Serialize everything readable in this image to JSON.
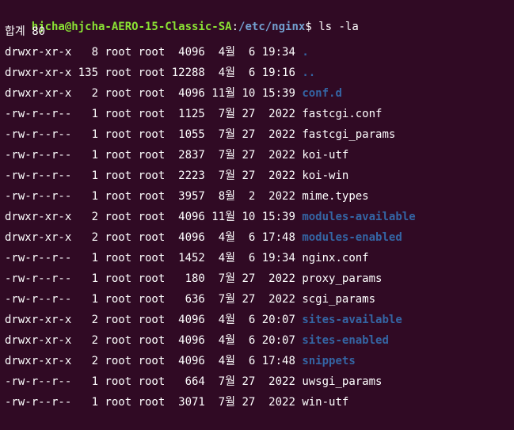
{
  "terminal": {
    "background": "#300a24",
    "colors": {
      "user": "#8ae234",
      "path": "#729fcf",
      "dir": "#3465a4",
      "text": "#ffffff"
    },
    "prompt": {
      "user_host": "hjcha@hjcha-AERO-15-Classic-SA",
      "colon": ":",
      "path": "/etc/nginx",
      "symbol": "$"
    },
    "command": "ls -la",
    "total": "합계 80",
    "entries": [
      {
        "meta": "drwxr-xr-x   8 root root  4096  4월  6 19:34 ",
        "name": ".",
        "type": "dir"
      },
      {
        "meta": "drwxr-xr-x 135 root root 12288  4월  6 19:16 ",
        "name": "..",
        "type": "dir"
      },
      {
        "meta": "drwxr-xr-x   2 root root  4096 11월 10 15:39 ",
        "name": "conf.d",
        "type": "dir"
      },
      {
        "meta": "-rw-r--r--   1 root root  1125  7월 27  2022 ",
        "name": "fastcgi.conf",
        "type": "file"
      },
      {
        "meta": "-rw-r--r--   1 root root  1055  7월 27  2022 ",
        "name": "fastcgi_params",
        "type": "file"
      },
      {
        "meta": "-rw-r--r--   1 root root  2837  7월 27  2022 ",
        "name": "koi-utf",
        "type": "file"
      },
      {
        "meta": "-rw-r--r--   1 root root  2223  7월 27  2022 ",
        "name": "koi-win",
        "type": "file"
      },
      {
        "meta": "-rw-r--r--   1 root root  3957  8월  2  2022 ",
        "name": "mime.types",
        "type": "file"
      },
      {
        "meta": "drwxr-xr-x   2 root root  4096 11월 10 15:39 ",
        "name": "modules-available",
        "type": "dir"
      },
      {
        "meta": "drwxr-xr-x   2 root root  4096  4월  6 17:48 ",
        "name": "modules-enabled",
        "type": "dir"
      },
      {
        "meta": "-rw-r--r--   1 root root  1452  4월  6 19:34 ",
        "name": "nginx.conf",
        "type": "file"
      },
      {
        "meta": "-rw-r--r--   1 root root   180  7월 27  2022 ",
        "name": "proxy_params",
        "type": "file"
      },
      {
        "meta": "-rw-r--r--   1 root root   636  7월 27  2022 ",
        "name": "scgi_params",
        "type": "file"
      },
      {
        "meta": "drwxr-xr-x   2 root root  4096  4월  6 20:07 ",
        "name": "sites-available",
        "type": "dir"
      },
      {
        "meta": "drwxr-xr-x   2 root root  4096  4월  6 20:07 ",
        "name": "sites-enabled",
        "type": "dir"
      },
      {
        "meta": "drwxr-xr-x   2 root root  4096  4월  6 17:48 ",
        "name": "snippets",
        "type": "dir"
      },
      {
        "meta": "-rw-r--r--   1 root root   664  7월 27  2022 ",
        "name": "uwsgi_params",
        "type": "file"
      },
      {
        "meta": "-rw-r--r--   1 root root  3071  7월 27  2022 ",
        "name": "win-utf",
        "type": "file"
      }
    ]
  }
}
